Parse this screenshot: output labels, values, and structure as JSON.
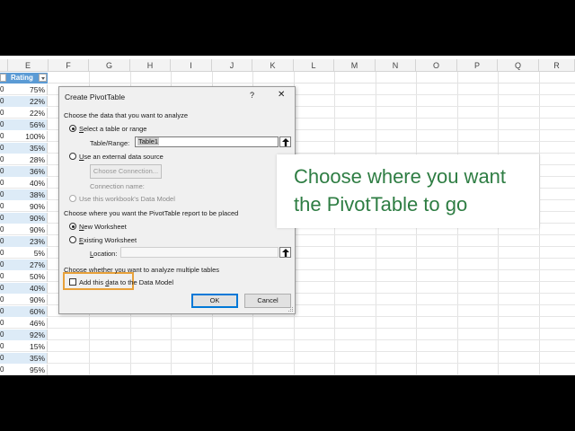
{
  "spreadsheet": {
    "columns": [
      "E",
      "F",
      "G",
      "H",
      "I",
      "J",
      "K",
      "L",
      "M",
      "N",
      "O",
      "P",
      "Q",
      "R"
    ],
    "rating_header": "Rating",
    "left_col_value": "0",
    "ratings": [
      "75%",
      "22%",
      "22%",
      "56%",
      "100%",
      "35%",
      "28%",
      "36%",
      "40%",
      "38%",
      "90%",
      "90%",
      "90%",
      "23%",
      "5%",
      "27%",
      "50%",
      "40%",
      "90%",
      "60%",
      "46%",
      "92%",
      "15%",
      "35%",
      "95%"
    ],
    "band_color": "#ddebf7",
    "header_color": "#5b9bd5"
  },
  "dialog": {
    "title": "Create PivotTable",
    "help": "?",
    "close": "✕",
    "section1": "Choose the data that you want to analyze",
    "opt_select_table": "Select a table or range",
    "table_range_label": "Table/Range:",
    "table_range_value": "Table1",
    "opt_external": "Use an external data source",
    "choose_connection": "Choose Connection...",
    "connection_name": "Connection name:",
    "opt_data_model": "Use this workbook's Data Model",
    "section2": "Choose where you want the PivotTable report to be placed",
    "opt_new_ws": "New Worksheet",
    "opt_existing_ws": "Existing Worksheet",
    "location_label": "Location:",
    "section3": "Choose whether you want to analyze multiple tables",
    "add_data_model": "Add this data to the Data Model",
    "ok": "OK",
    "cancel": "Cancel",
    "highlight_color": "#e8a13a"
  },
  "callout": {
    "line1": "Choose where you want",
    "line2": "the PivotTable to go",
    "color": "#2e7d43"
  }
}
